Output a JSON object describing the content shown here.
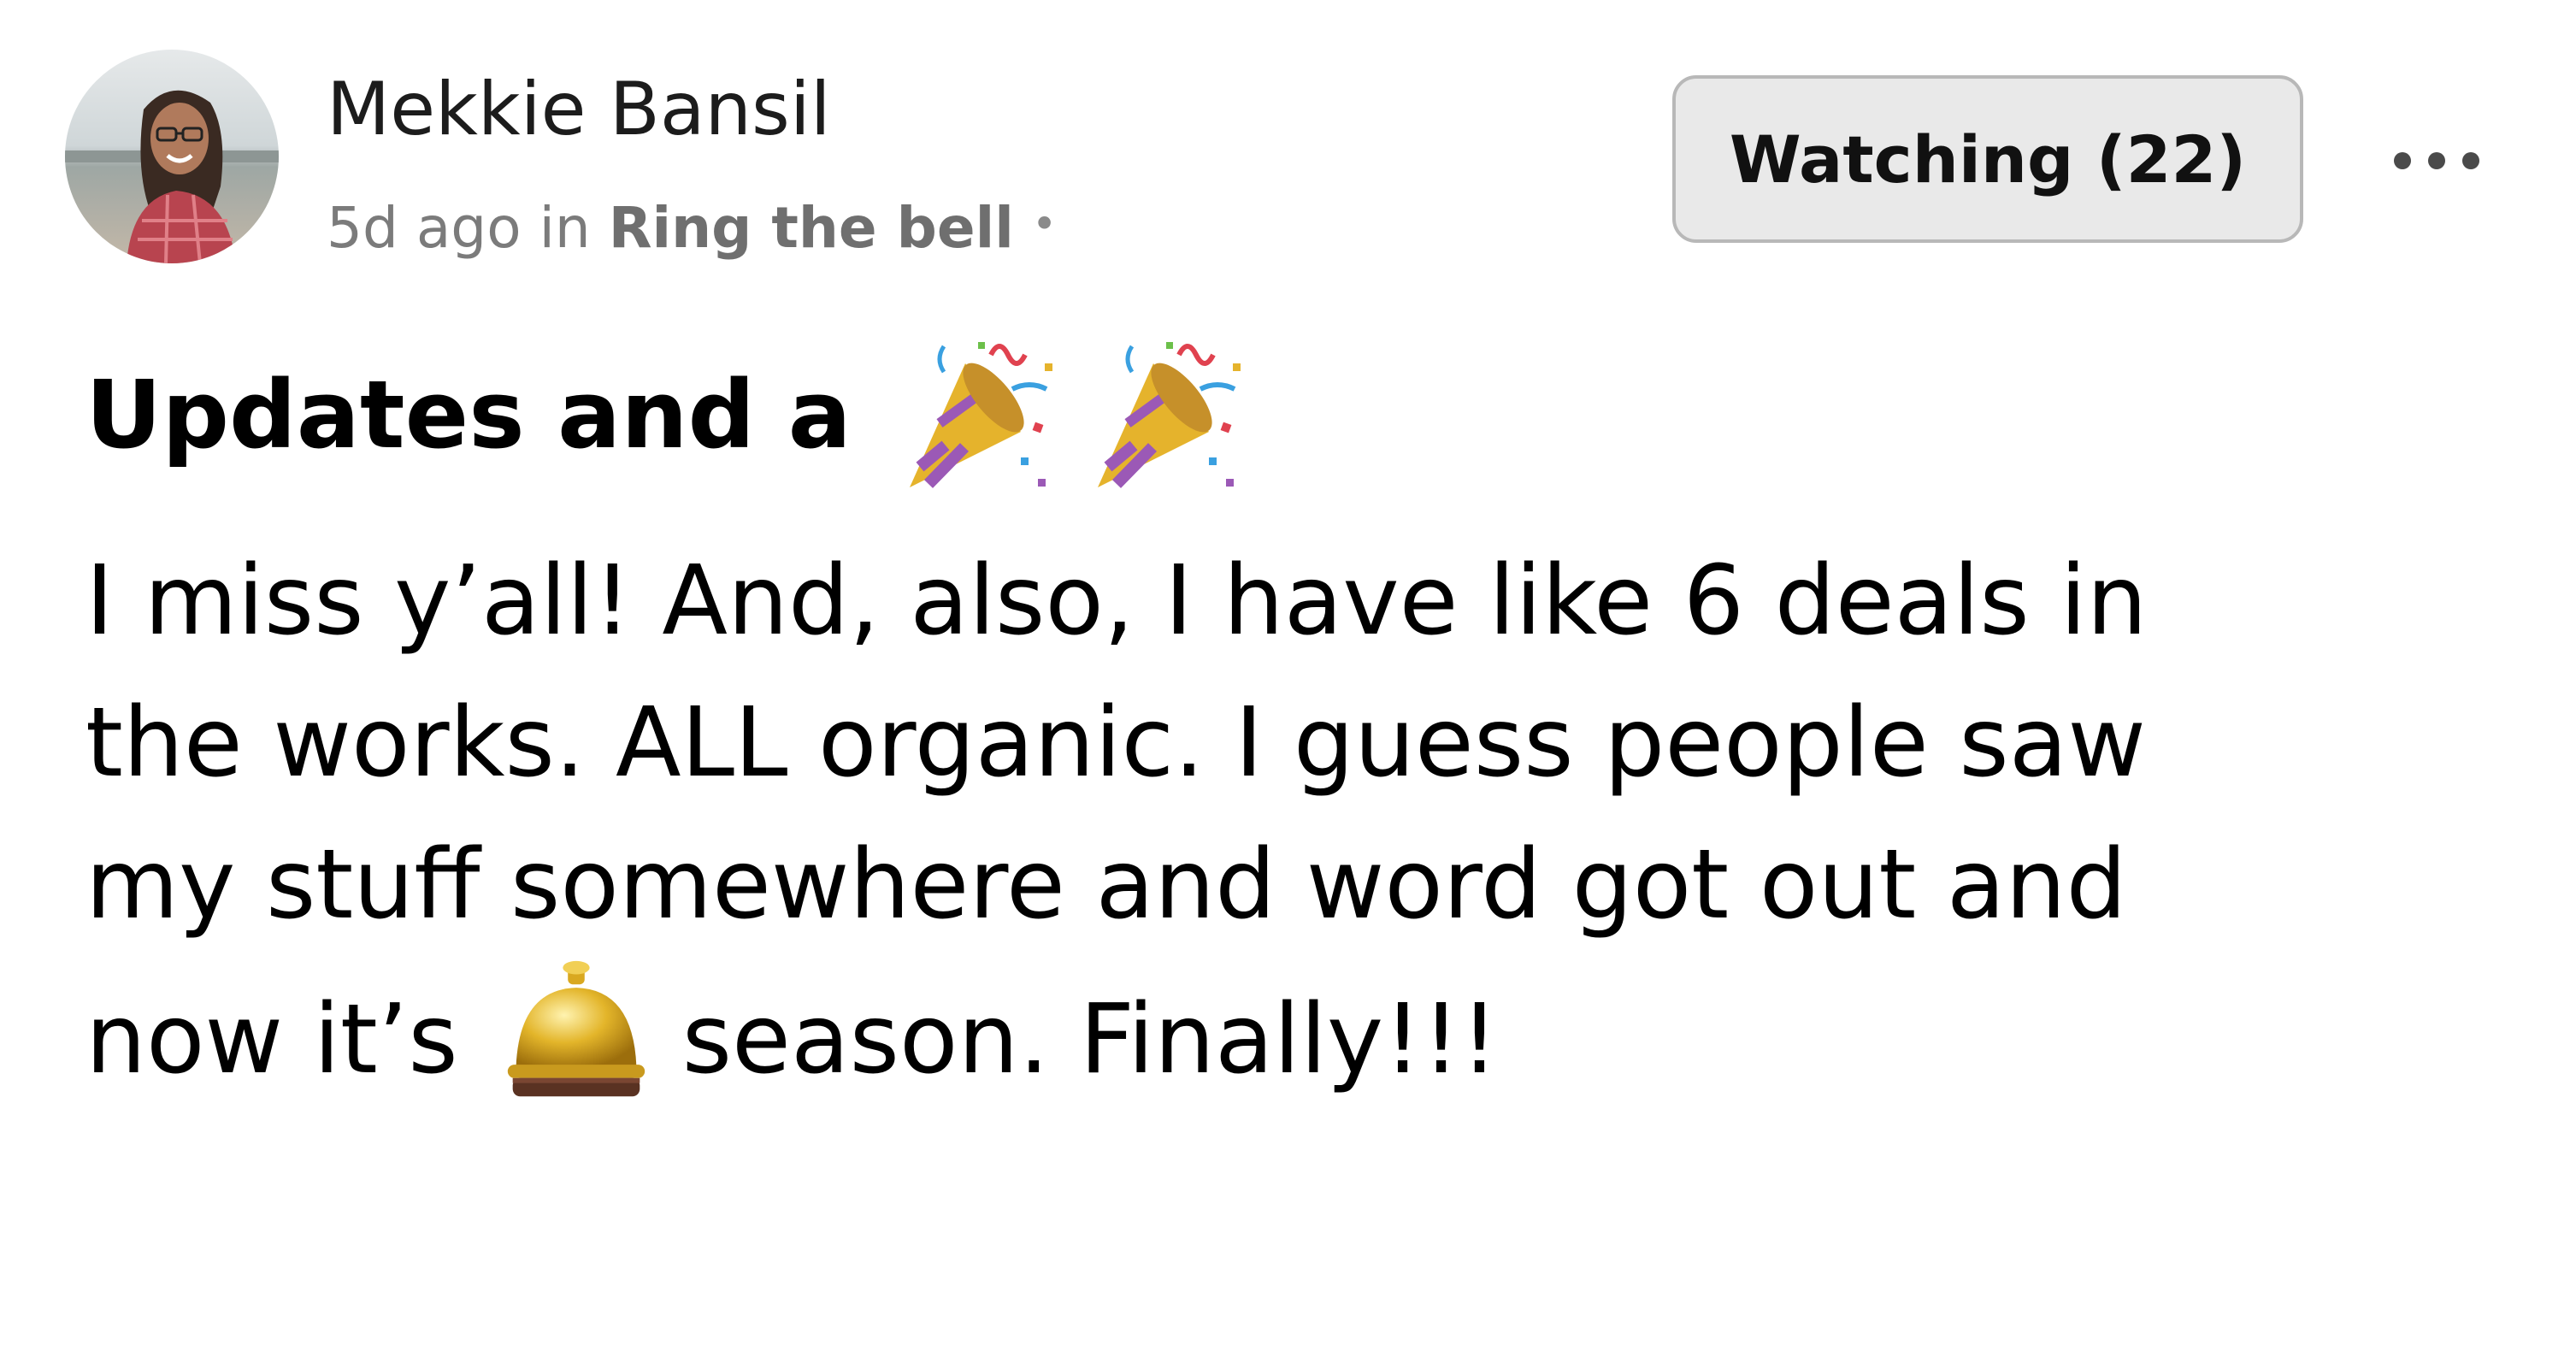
{
  "post": {
    "author": {
      "name": "Mekkie Bansil",
      "avatar_icon": "avatar-photo"
    },
    "meta": {
      "time": "5d ago",
      "in_label": "in",
      "space": "Ring the bell",
      "separator": "•"
    },
    "watch_button": {
      "label": "Watching (22)"
    },
    "more_button": {
      "icon": "more-horizontal-icon"
    },
    "title": {
      "text": "Updates and a",
      "emojis": [
        "party-popper-icon",
        "party-popper-icon"
      ]
    },
    "body": {
      "line1": "I miss y’all! And, also, I have like 6 deals in",
      "line2": "the works. ALL organic. I guess people saw",
      "line3": "my stuff somewhere and word got out and",
      "line4_before": "now it’s",
      "line4_emoji": "bellhop-bell-icon",
      "line4_after": "season. Finally!!!"
    }
  },
  "colors": {
    "text": "#000000",
    "muted": "#7b7b7b",
    "button_bg": "#e9e9e9",
    "button_border": "#b8b8b8"
  }
}
